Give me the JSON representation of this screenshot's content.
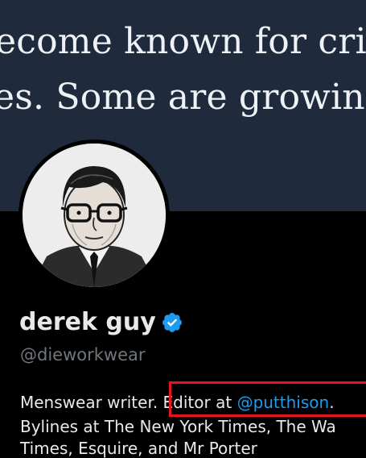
{
  "banner": {
    "line1": "ecome known for critici",
    "line2": "es. Some are growing tir"
  },
  "profile": {
    "display_name": "derek guy",
    "handle": "@dieworkwear",
    "bio_part1": "Menswear writer. ",
    "bio_part2": "Editor at ",
    "bio_link": "@putthison",
    "bio_part3": ".",
    "bio_line2": "Bylines at The New York Times, The Wa",
    "bio_line3": "Times, Esquire, and Mr Porter"
  },
  "colors": {
    "accent": "#1d9bf0",
    "highlight": "#e8131f",
    "banner_bg": "#1f2a3d"
  }
}
